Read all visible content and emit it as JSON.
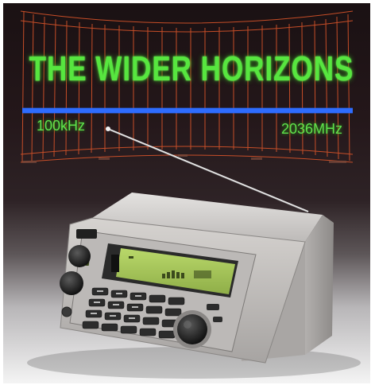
{
  "advert": {
    "headline": "THE WIDER HORIZONS",
    "frequency_low": "100kHz",
    "frequency_high": "2036MHz"
  },
  "colors": {
    "grid_orange": "#d8542a",
    "band_blue": "#2e6cff",
    "headline_green": "#57e63f",
    "lcd_green": "#a9c95a",
    "scanner_body": "#c9c6c4"
  },
  "icons": [
    "radio-scanner",
    "telescopic-antenna",
    "tuning-knob"
  ]
}
